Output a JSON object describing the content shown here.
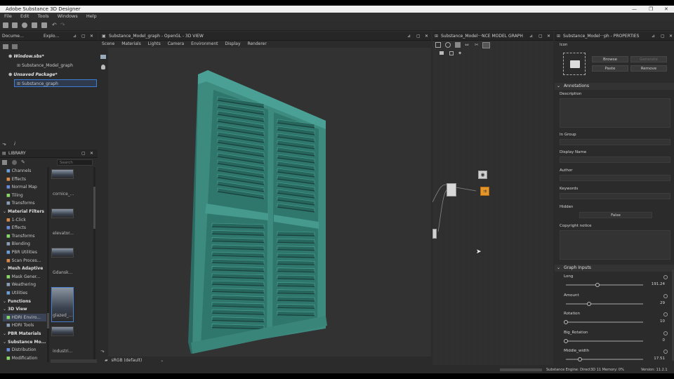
{
  "window": {
    "title": "Adobe Substance 3D Designer",
    "controls": [
      "—",
      "❐",
      "✕"
    ]
  },
  "menu": [
    "File",
    "Edit",
    "Tools",
    "Windows",
    "Help"
  ],
  "explorer": {
    "tab_label": "Docume…",
    "tab2_label": "Explo…",
    "items": [
      {
        "label": "Window.sbs*",
        "bold": true
      },
      {
        "label": "Substance_Model_graph"
      },
      {
        "label": "Unsaved Package*",
        "bold": true
      },
      {
        "label": "Substance_graph",
        "selected": true
      }
    ]
  },
  "library": {
    "title": "LIBRARY",
    "search_placeholder": "Search",
    "categories": [
      {
        "label": "Channels"
      },
      {
        "label": "Effects"
      },
      {
        "label": "Normal Map"
      },
      {
        "label": "Tiling"
      },
      {
        "label": "Transforms"
      },
      {
        "label": "Material Filters",
        "head": true
      },
      {
        "label": "1-Click"
      },
      {
        "label": "Effects"
      },
      {
        "label": "Transforms"
      },
      {
        "label": "Blending"
      },
      {
        "label": "PBR Utilities"
      },
      {
        "label": "Scan Proces..."
      },
      {
        "label": "Mesh Adaptive",
        "head": true
      },
      {
        "label": "Mask Gener..."
      },
      {
        "label": "Weathering"
      },
      {
        "label": "Utilities"
      },
      {
        "label": "Functions",
        "head": true
      },
      {
        "label": "3D View",
        "head": true
      },
      {
        "label": "HDRI Enviro...",
        "selected": true
      },
      {
        "label": "HDRI Tools"
      },
      {
        "label": "PBR Materials",
        "head": true
      },
      {
        "label": "Substance Mo...",
        "head": true
      },
      {
        "label": "Distribution"
      },
      {
        "label": "Modification"
      }
    ],
    "thumbs": [
      "cornice_...",
      "elevator...",
      "Gdansk...",
      "glazed_...",
      "industri..."
    ]
  },
  "viewport": {
    "tab_label": "Substance_Model_graph - OpenGL - 3D VIEW",
    "menu": [
      "Scene",
      "Materials",
      "Lights",
      "Camera",
      "Environment",
      "Display",
      "Renderer"
    ],
    "colorspace": "sRGB (default)"
  },
  "graph": {
    "tab_label": "Substance_Model···NCE MODEL GRAPH"
  },
  "properties": {
    "tab_label": "Substance_Model···ph - PROPERTIES",
    "icon_label": "Icon",
    "buttons": {
      "browse": "Browse",
      "generate": "Generate",
      "paste": "Paste",
      "remove": "Remove"
    },
    "annotations_title": "Annotations",
    "fields": {
      "description": "Description",
      "in_group": "In Group",
      "display_name": "Display Name",
      "author": "Author",
      "keywords": "Keywords",
      "hidden": "Hidden",
      "hidden_value": "False",
      "copyright": "Copyright notice"
    },
    "graph_inputs_title": "Graph Inputs",
    "inputs": [
      {
        "label": "Long",
        "value": "191.24",
        "fraction": 0.3
      },
      {
        "label": "Amount",
        "value": "29",
        "fraction": 0.22
      },
      {
        "label": "Rotation",
        "value": "10",
        "fraction": 0.0
      },
      {
        "label": "Big_Rotation",
        "value": "0",
        "fraction": 0.0
      },
      {
        "label": "Middle_width",
        "value": "17.51",
        "fraction": 0.13
      }
    ]
  },
  "status": {
    "engine": "Substance Engine: Direct3D 11  Memory: 0%",
    "version": "Version: 11.2.1"
  }
}
